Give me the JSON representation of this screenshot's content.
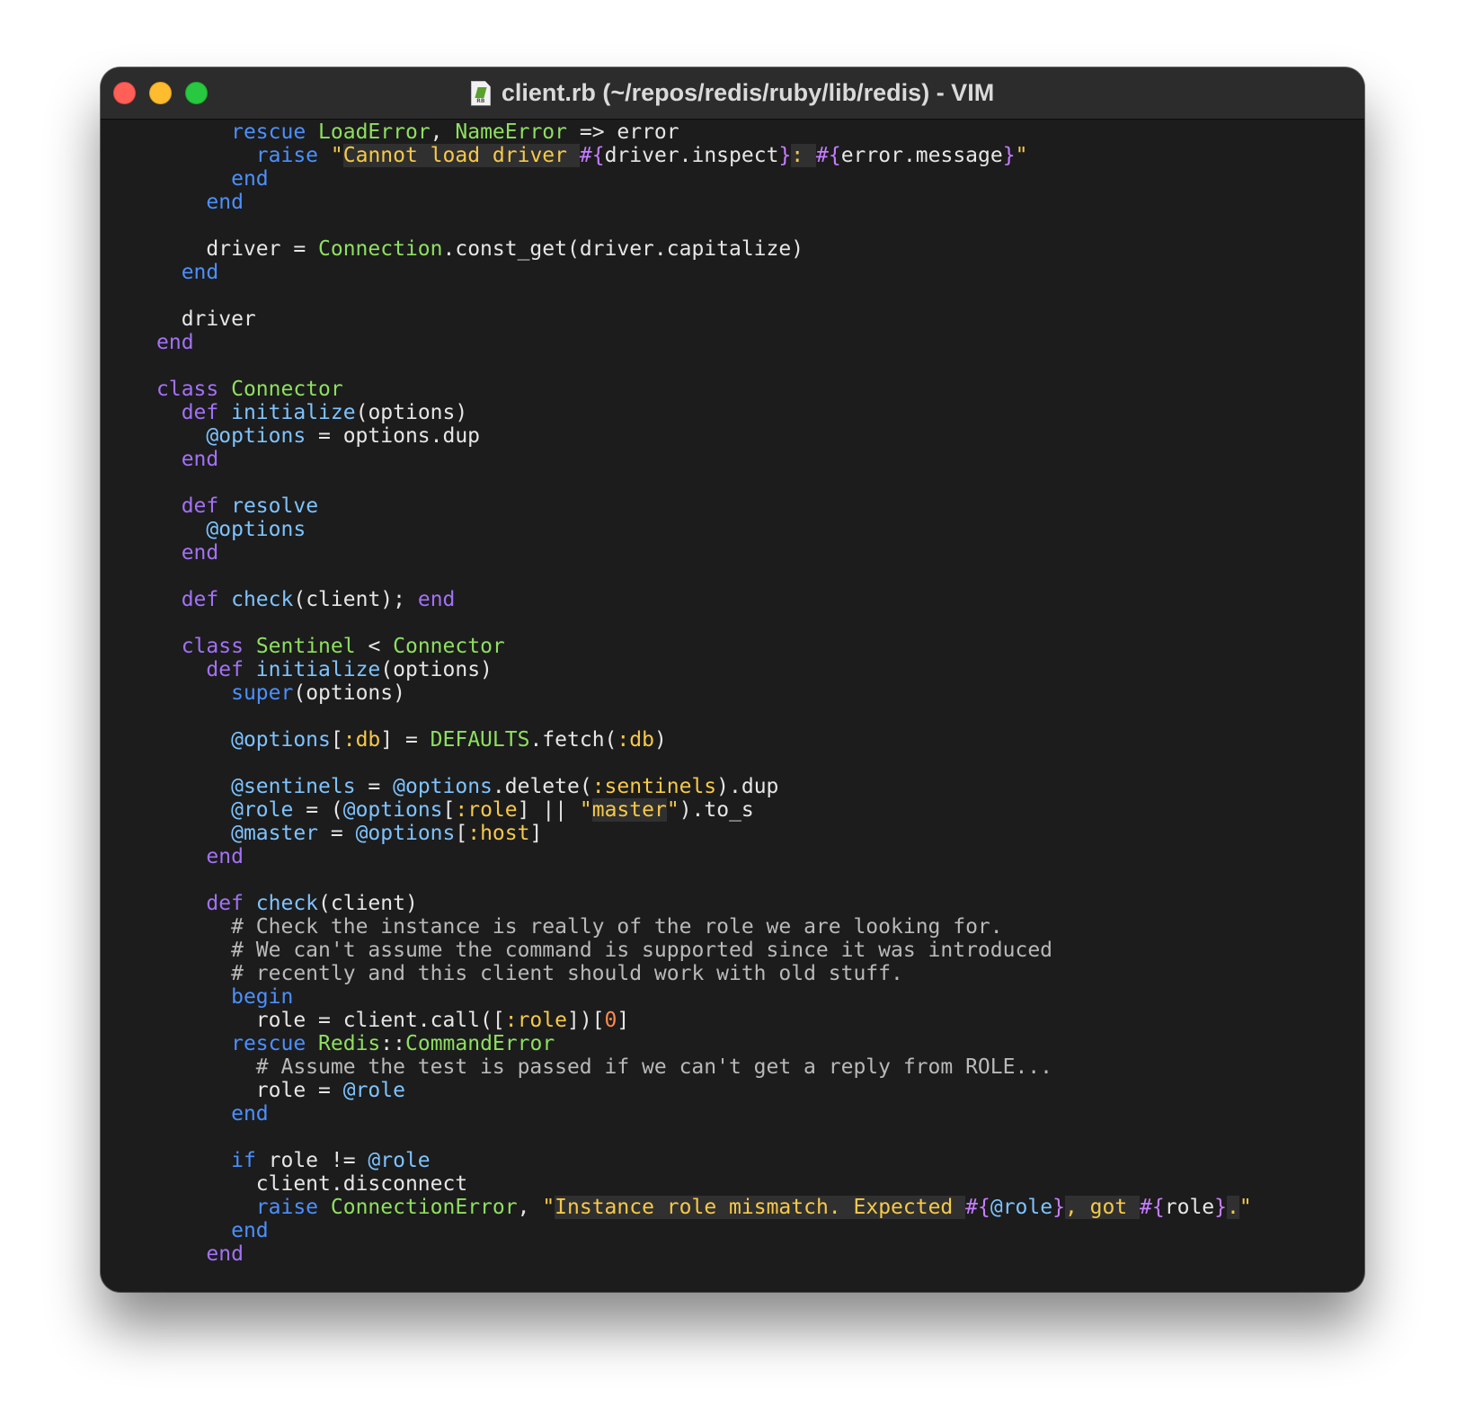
{
  "window": {
    "title": "client.rb (~/repos/redis/ruby/lib/redis) - VIM",
    "file_icon": "ruby-file-icon",
    "traffic_lights": {
      "close": "#ff5f57",
      "minimize": "#febc2e",
      "zoom": "#28c840"
    }
  },
  "colors": {
    "background": "#1c1c1c",
    "keyword": "#a371f7",
    "keyword_blue": "#4b90ff",
    "constant": "#8ee05f",
    "method": "#7ec3ff",
    "symbol_string": "#f7c948",
    "interpolation": "#c77dff",
    "number": "#ff8a4c",
    "comment": "#b9b9b9"
  },
  "editor": {
    "lines": [
      [
        [
          "      ",
          "p"
        ],
        [
          "rescue",
          "kw2"
        ],
        [
          " ",
          "p"
        ],
        [
          "LoadError",
          "const"
        ],
        [
          ", ",
          "p"
        ],
        [
          "NameError",
          "const"
        ],
        [
          " => error",
          "p"
        ]
      ],
      [
        [
          "        ",
          "p"
        ],
        [
          "raise",
          "kw2"
        ],
        [
          " ",
          "p"
        ],
        [
          "\"",
          "str"
        ],
        [
          "Cannot load driver ",
          "strbg"
        ],
        [
          "#{",
          "interp"
        ],
        [
          "driver.inspect",
          "p"
        ],
        [
          "}",
          "interp"
        ],
        [
          ": ",
          "strbg"
        ],
        [
          "#{",
          "interp"
        ],
        [
          "error.message",
          "p"
        ],
        [
          "}",
          "interp"
        ],
        [
          "\"",
          "str"
        ]
      ],
      [
        [
          "      ",
          "p"
        ],
        [
          "end",
          "kw2"
        ]
      ],
      [
        [
          "    ",
          "p"
        ],
        [
          "end",
          "kw2"
        ]
      ],
      [
        [
          "",
          "p"
        ]
      ],
      [
        [
          "    driver = ",
          "p"
        ],
        [
          "Connection",
          "const"
        ],
        [
          ".const_get(driver.capitalize)",
          "p"
        ]
      ],
      [
        [
          "  ",
          "p"
        ],
        [
          "end",
          "kw2"
        ]
      ],
      [
        [
          "",
          "p"
        ]
      ],
      [
        [
          "  driver",
          "p"
        ]
      ],
      [
        [
          "end",
          "kw"
        ]
      ],
      [
        [
          "",
          "p"
        ]
      ],
      [
        [
          "class",
          "kw"
        ],
        [
          " ",
          "p"
        ],
        [
          "Connector",
          "const"
        ]
      ],
      [
        [
          "  ",
          "p"
        ],
        [
          "def",
          "kw"
        ],
        [
          " ",
          "p"
        ],
        [
          "initialize",
          "fn"
        ],
        [
          "(options)",
          "p"
        ]
      ],
      [
        [
          "    ",
          "p"
        ],
        [
          "@options",
          "ivar"
        ],
        [
          " = options.dup",
          "p"
        ]
      ],
      [
        [
          "  ",
          "p"
        ],
        [
          "end",
          "kw"
        ]
      ],
      [
        [
          "",
          "p"
        ]
      ],
      [
        [
          "  ",
          "p"
        ],
        [
          "def",
          "kw"
        ],
        [
          " ",
          "p"
        ],
        [
          "resolve",
          "fn"
        ]
      ],
      [
        [
          "    ",
          "p"
        ],
        [
          "@options",
          "ivar"
        ]
      ],
      [
        [
          "  ",
          "p"
        ],
        [
          "end",
          "kw"
        ]
      ],
      [
        [
          "",
          "p"
        ]
      ],
      [
        [
          "  ",
          "p"
        ],
        [
          "def",
          "kw"
        ],
        [
          " ",
          "p"
        ],
        [
          "check",
          "fn"
        ],
        [
          "(client); ",
          "p"
        ],
        [
          "end",
          "kw"
        ]
      ],
      [
        [
          "",
          "p"
        ]
      ],
      [
        [
          "  ",
          "p"
        ],
        [
          "class",
          "kw"
        ],
        [
          " ",
          "p"
        ],
        [
          "Sentinel",
          "const"
        ],
        [
          " < ",
          "p"
        ],
        [
          "Connector",
          "const"
        ]
      ],
      [
        [
          "    ",
          "p"
        ],
        [
          "def",
          "kw"
        ],
        [
          " ",
          "p"
        ],
        [
          "initialize",
          "fn"
        ],
        [
          "(options)",
          "p"
        ]
      ],
      [
        [
          "      ",
          "p"
        ],
        [
          "super",
          "kw2"
        ],
        [
          "(options)",
          "p"
        ]
      ],
      [
        [
          "",
          "p"
        ]
      ],
      [
        [
          "      ",
          "p"
        ],
        [
          "@options",
          "ivar"
        ],
        [
          "[",
          "p"
        ],
        [
          ":db",
          "sym"
        ],
        [
          "] = ",
          "p"
        ],
        [
          "DEFAULTS",
          "const"
        ],
        [
          ".fetch(",
          "p"
        ],
        [
          ":db",
          "sym"
        ],
        [
          ")",
          "p"
        ]
      ],
      [
        [
          "",
          "p"
        ]
      ],
      [
        [
          "      ",
          "p"
        ],
        [
          "@sentinels",
          "ivar"
        ],
        [
          " = ",
          "p"
        ],
        [
          "@options",
          "ivar"
        ],
        [
          ".delete(",
          "p"
        ],
        [
          ":sentinels",
          "sym"
        ],
        [
          ").dup",
          "p"
        ]
      ],
      [
        [
          "      ",
          "p"
        ],
        [
          "@role",
          "ivar"
        ],
        [
          " = (",
          "p"
        ],
        [
          "@options",
          "ivar"
        ],
        [
          "[",
          "p"
        ],
        [
          ":role",
          "sym"
        ],
        [
          "] || ",
          "p"
        ],
        [
          "\"",
          "str"
        ],
        [
          "master",
          "strbg"
        ],
        [
          "\"",
          "str"
        ],
        [
          ").to_s",
          "p"
        ]
      ],
      [
        [
          "      ",
          "p"
        ],
        [
          "@master",
          "ivar"
        ],
        [
          " = ",
          "p"
        ],
        [
          "@options",
          "ivar"
        ],
        [
          "[",
          "p"
        ],
        [
          ":host",
          "sym"
        ],
        [
          "]",
          "p"
        ]
      ],
      [
        [
          "    ",
          "p"
        ],
        [
          "end",
          "kw"
        ]
      ],
      [
        [
          "",
          "p"
        ]
      ],
      [
        [
          "    ",
          "p"
        ],
        [
          "def",
          "kw"
        ],
        [
          " ",
          "p"
        ],
        [
          "check",
          "fn"
        ],
        [
          "(client)",
          "p"
        ]
      ],
      [
        [
          "      ",
          "p"
        ],
        [
          "# Check the instance is really of the role we are looking for.",
          "comment"
        ]
      ],
      [
        [
          "      ",
          "p"
        ],
        [
          "# We can't assume the command is supported since it was introduced",
          "comment"
        ]
      ],
      [
        [
          "      ",
          "p"
        ],
        [
          "# recently and this client should work with old stuff.",
          "comment"
        ]
      ],
      [
        [
          "      ",
          "p"
        ],
        [
          "begin",
          "kw2"
        ]
      ],
      [
        [
          "        role = client.call([",
          "p"
        ],
        [
          ":role",
          "sym"
        ],
        [
          "])[",
          "p"
        ],
        [
          "0",
          "num"
        ],
        [
          "]",
          "p"
        ]
      ],
      [
        [
          "      ",
          "p"
        ],
        [
          "rescue",
          "kw2"
        ],
        [
          " ",
          "p"
        ],
        [
          "Redis",
          "const"
        ],
        [
          "::",
          "p"
        ],
        [
          "CommandError",
          "const"
        ]
      ],
      [
        [
          "        ",
          "p"
        ],
        [
          "# Assume the test is passed if we can't get a reply from ROLE...",
          "comment"
        ]
      ],
      [
        [
          "        role = ",
          "p"
        ],
        [
          "@role",
          "ivar"
        ]
      ],
      [
        [
          "      ",
          "p"
        ],
        [
          "end",
          "kw2"
        ]
      ],
      [
        [
          "",
          "p"
        ]
      ],
      [
        [
          "      ",
          "p"
        ],
        [
          "if",
          "kw2"
        ],
        [
          " role != ",
          "p"
        ],
        [
          "@role",
          "ivar"
        ]
      ],
      [
        [
          "        client.disconnect",
          "p"
        ]
      ],
      [
        [
          "        ",
          "p"
        ],
        [
          "raise",
          "kw2"
        ],
        [
          " ",
          "p"
        ],
        [
          "ConnectionError",
          "const"
        ],
        [
          ", ",
          "p"
        ],
        [
          "\"",
          "str"
        ],
        [
          "Instance role mismatch. Expected ",
          "strbg"
        ],
        [
          "#{",
          "interp"
        ],
        [
          "@role",
          "ivar"
        ],
        [
          "}",
          "interp"
        ],
        [
          ", got ",
          "strbg"
        ],
        [
          "#{",
          "interp"
        ],
        [
          "role",
          "p"
        ],
        [
          "}",
          "interp"
        ],
        [
          ".",
          "strbg"
        ],
        [
          "\"",
          "str"
        ]
      ],
      [
        [
          "      ",
          "p"
        ],
        [
          "end",
          "kw2"
        ]
      ],
      [
        [
          "    ",
          "p"
        ],
        [
          "end",
          "kw"
        ]
      ]
    ]
  }
}
